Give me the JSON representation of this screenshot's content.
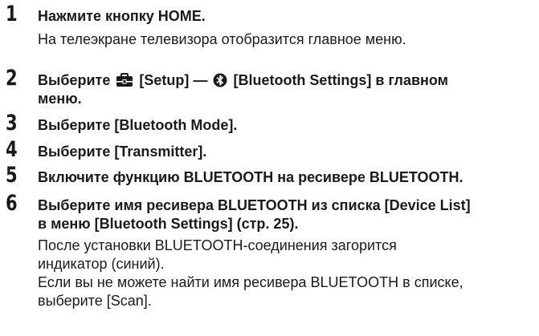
{
  "steps": [
    {
      "number": "1",
      "instruction": "Нажмите кнопку HOME.",
      "description": "На телеэкране телевизора отобразится главное меню."
    },
    {
      "number": "2",
      "instruction_pre": "Выберите",
      "instruction_mid": "[Setup] —",
      "instruction_post": "[Bluetooth Settings] в главном",
      "instruction_line2": "меню.",
      "icons": [
        "toolbox-icon",
        "bluetooth-icon"
      ]
    },
    {
      "number": "3",
      "instruction": "Выберите [Bluetooth Mode]."
    },
    {
      "number": "4",
      "instruction": "Выберите [Transmitter]."
    },
    {
      "number": "5",
      "instruction": "Включите функцию BLUETOOTH на ресивере BLUETOOTH."
    },
    {
      "number": "6",
      "instruction_line1": "Выберите имя ресивера BLUETOOTH из списка [Device List]",
      "instruction_line2": "в меню [Bluetooth Settings] (стр. 25).",
      "description_lines": [
        "После установки BLUETOOTH-соединения загорится",
        "индикатор (синий).",
        "Если вы не можете найти имя ресивера BLUETOOTH в списке,",
        "выберите [Scan]."
      ]
    }
  ]
}
